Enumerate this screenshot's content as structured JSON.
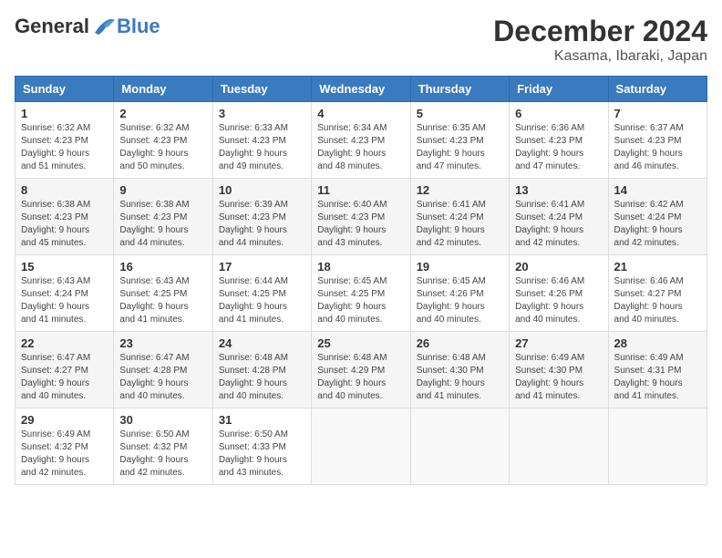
{
  "logo": {
    "general": "General",
    "blue": "Blue"
  },
  "title": "December 2024",
  "subtitle": "Kasama, Ibaraki, Japan",
  "days_of_week": [
    "Sunday",
    "Monday",
    "Tuesday",
    "Wednesday",
    "Thursday",
    "Friday",
    "Saturday"
  ],
  "weeks": [
    [
      {
        "day": "1",
        "info": "Sunrise: 6:32 AM\nSunset: 4:23 PM\nDaylight: 9 hours\nand 51 minutes."
      },
      {
        "day": "2",
        "info": "Sunrise: 6:32 AM\nSunset: 4:23 PM\nDaylight: 9 hours\nand 50 minutes."
      },
      {
        "day": "3",
        "info": "Sunrise: 6:33 AM\nSunset: 4:23 PM\nDaylight: 9 hours\nand 49 minutes."
      },
      {
        "day": "4",
        "info": "Sunrise: 6:34 AM\nSunset: 4:23 PM\nDaylight: 9 hours\nand 48 minutes."
      },
      {
        "day": "5",
        "info": "Sunrise: 6:35 AM\nSunset: 4:23 PM\nDaylight: 9 hours\nand 47 minutes."
      },
      {
        "day": "6",
        "info": "Sunrise: 6:36 AM\nSunset: 4:23 PM\nDaylight: 9 hours\nand 47 minutes."
      },
      {
        "day": "7",
        "info": "Sunrise: 6:37 AM\nSunset: 4:23 PM\nDaylight: 9 hours\nand 46 minutes."
      }
    ],
    [
      {
        "day": "8",
        "info": "Sunrise: 6:38 AM\nSunset: 4:23 PM\nDaylight: 9 hours\nand 45 minutes."
      },
      {
        "day": "9",
        "info": "Sunrise: 6:38 AM\nSunset: 4:23 PM\nDaylight: 9 hours\nand 44 minutes."
      },
      {
        "day": "10",
        "info": "Sunrise: 6:39 AM\nSunset: 4:23 PM\nDaylight: 9 hours\nand 44 minutes."
      },
      {
        "day": "11",
        "info": "Sunrise: 6:40 AM\nSunset: 4:23 PM\nDaylight: 9 hours\nand 43 minutes."
      },
      {
        "day": "12",
        "info": "Sunrise: 6:41 AM\nSunset: 4:24 PM\nDaylight: 9 hours\nand 42 minutes."
      },
      {
        "day": "13",
        "info": "Sunrise: 6:41 AM\nSunset: 4:24 PM\nDaylight: 9 hours\nand 42 minutes."
      },
      {
        "day": "14",
        "info": "Sunrise: 6:42 AM\nSunset: 4:24 PM\nDaylight: 9 hours\nand 42 minutes."
      }
    ],
    [
      {
        "day": "15",
        "info": "Sunrise: 6:43 AM\nSunset: 4:24 PM\nDaylight: 9 hours\nand 41 minutes."
      },
      {
        "day": "16",
        "info": "Sunrise: 6:43 AM\nSunset: 4:25 PM\nDaylight: 9 hours\nand 41 minutes."
      },
      {
        "day": "17",
        "info": "Sunrise: 6:44 AM\nSunset: 4:25 PM\nDaylight: 9 hours\nand 41 minutes."
      },
      {
        "day": "18",
        "info": "Sunrise: 6:45 AM\nSunset: 4:25 PM\nDaylight: 9 hours\nand 40 minutes."
      },
      {
        "day": "19",
        "info": "Sunrise: 6:45 AM\nSunset: 4:26 PM\nDaylight: 9 hours\nand 40 minutes."
      },
      {
        "day": "20",
        "info": "Sunrise: 6:46 AM\nSunset: 4:26 PM\nDaylight: 9 hours\nand 40 minutes."
      },
      {
        "day": "21",
        "info": "Sunrise: 6:46 AM\nSunset: 4:27 PM\nDaylight: 9 hours\nand 40 minutes."
      }
    ],
    [
      {
        "day": "22",
        "info": "Sunrise: 6:47 AM\nSunset: 4:27 PM\nDaylight: 9 hours\nand 40 minutes."
      },
      {
        "day": "23",
        "info": "Sunrise: 6:47 AM\nSunset: 4:28 PM\nDaylight: 9 hours\nand 40 minutes."
      },
      {
        "day": "24",
        "info": "Sunrise: 6:48 AM\nSunset: 4:28 PM\nDaylight: 9 hours\nand 40 minutes."
      },
      {
        "day": "25",
        "info": "Sunrise: 6:48 AM\nSunset: 4:29 PM\nDaylight: 9 hours\nand 40 minutes."
      },
      {
        "day": "26",
        "info": "Sunrise: 6:48 AM\nSunset: 4:30 PM\nDaylight: 9 hours\nand 41 minutes."
      },
      {
        "day": "27",
        "info": "Sunrise: 6:49 AM\nSunset: 4:30 PM\nDaylight: 9 hours\nand 41 minutes."
      },
      {
        "day": "28",
        "info": "Sunrise: 6:49 AM\nSunset: 4:31 PM\nDaylight: 9 hours\nand 41 minutes."
      }
    ],
    [
      {
        "day": "29",
        "info": "Sunrise: 6:49 AM\nSunset: 4:32 PM\nDaylight: 9 hours\nand 42 minutes."
      },
      {
        "day": "30",
        "info": "Sunrise: 6:50 AM\nSunset: 4:32 PM\nDaylight: 9 hours\nand 42 minutes."
      },
      {
        "day": "31",
        "info": "Sunrise: 6:50 AM\nSunset: 4:33 PM\nDaylight: 9 hours\nand 43 minutes."
      },
      {
        "day": "",
        "info": ""
      },
      {
        "day": "",
        "info": ""
      },
      {
        "day": "",
        "info": ""
      },
      {
        "day": "",
        "info": ""
      }
    ]
  ]
}
